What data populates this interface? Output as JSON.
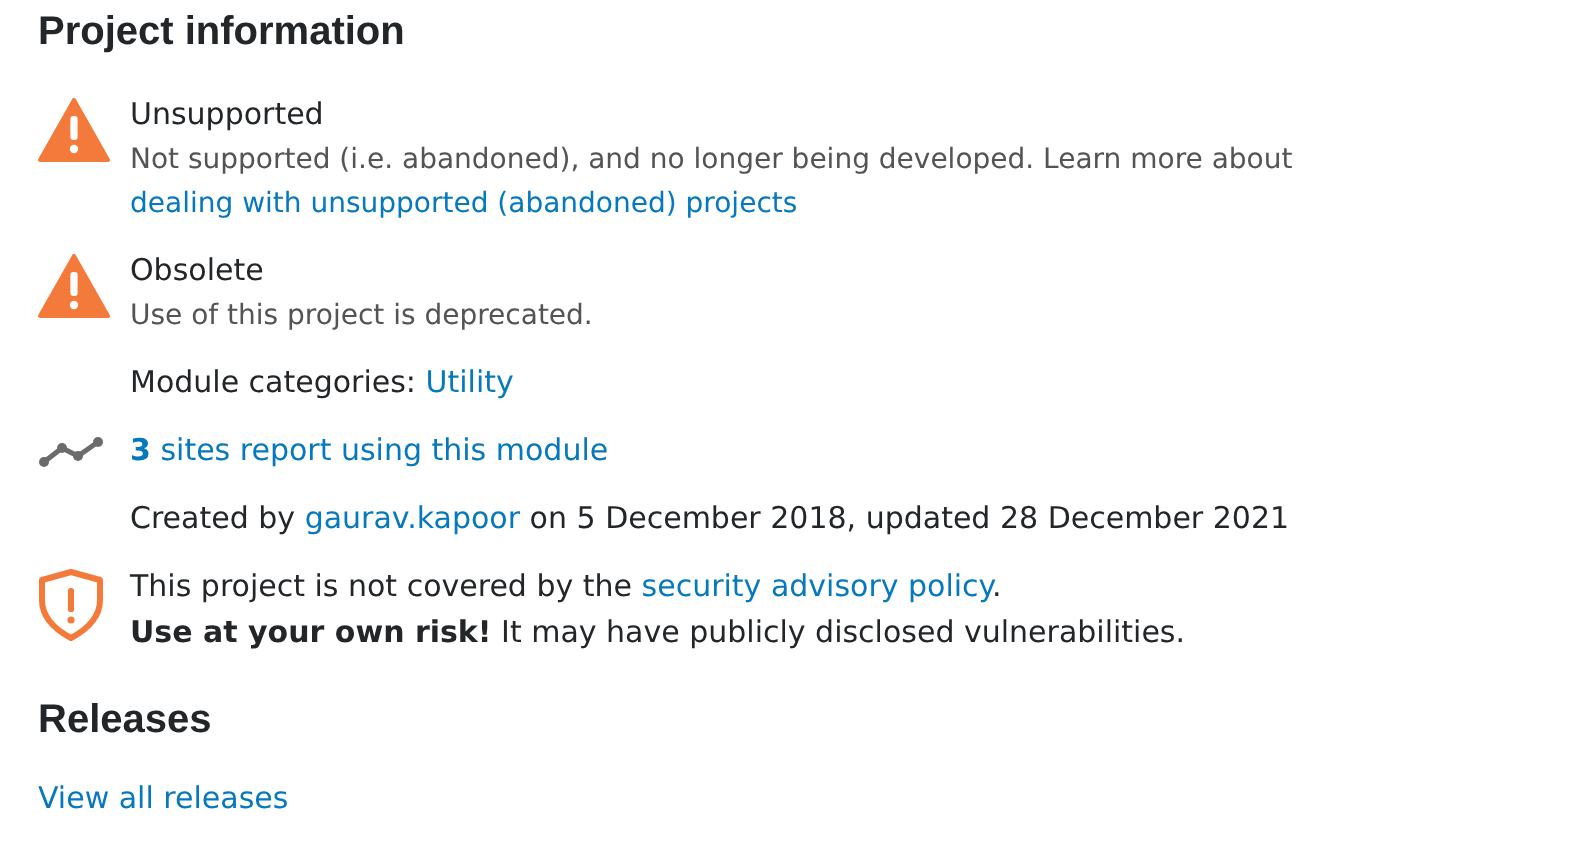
{
  "title": "Project information",
  "items": [
    {
      "kind": "warning",
      "heading": "Unsupported",
      "lines": [
        [
          {
            "text": "Not supported (i.e. abandoned), and no longer being developed. Learn more about ",
            "link": false
          },
          {
            "text": "dealing with unsupported (abandoned) projects",
            "link": true
          }
        ]
      ]
    },
    {
      "kind": "warning",
      "heading": "Obsolete",
      "lines": [
        [
          {
            "text": "Use of this project is deprecated.",
            "link": false
          }
        ]
      ]
    },
    {
      "kind": "plain",
      "lines": [
        [
          {
            "text": "Module categories: ",
            "link": false
          },
          {
            "text": "Utility",
            "link": true
          }
        ]
      ]
    },
    {
      "kind": "usage",
      "lines": [
        [
          {
            "text": "**3** sites report using this module",
            "link": true
          }
        ]
      ]
    },
    {
      "kind": "plain",
      "lines": [
        [
          {
            "text": "Created by ",
            "link": false
          },
          {
            "text": "gaurav.kapoor",
            "link": true
          },
          {
            "text": " on 5 December 2018, updated 28 December 2021",
            "link": false
          }
        ]
      ]
    },
    {
      "kind": "security",
      "lines": [
        [
          {
            "text": "This project is not covered by the ",
            "link": false
          },
          {
            "text": "security advisory policy",
            "link": true
          },
          {
            "text": ".",
            "link": false
          }
        ],
        [
          {
            "text": "**Use at your own risk!** It may have publicly disclosed vulnerabilities.",
            "link": false
          }
        ]
      ]
    }
  ],
  "releases": {
    "title": "Releases",
    "link": "View all releases"
  }
}
